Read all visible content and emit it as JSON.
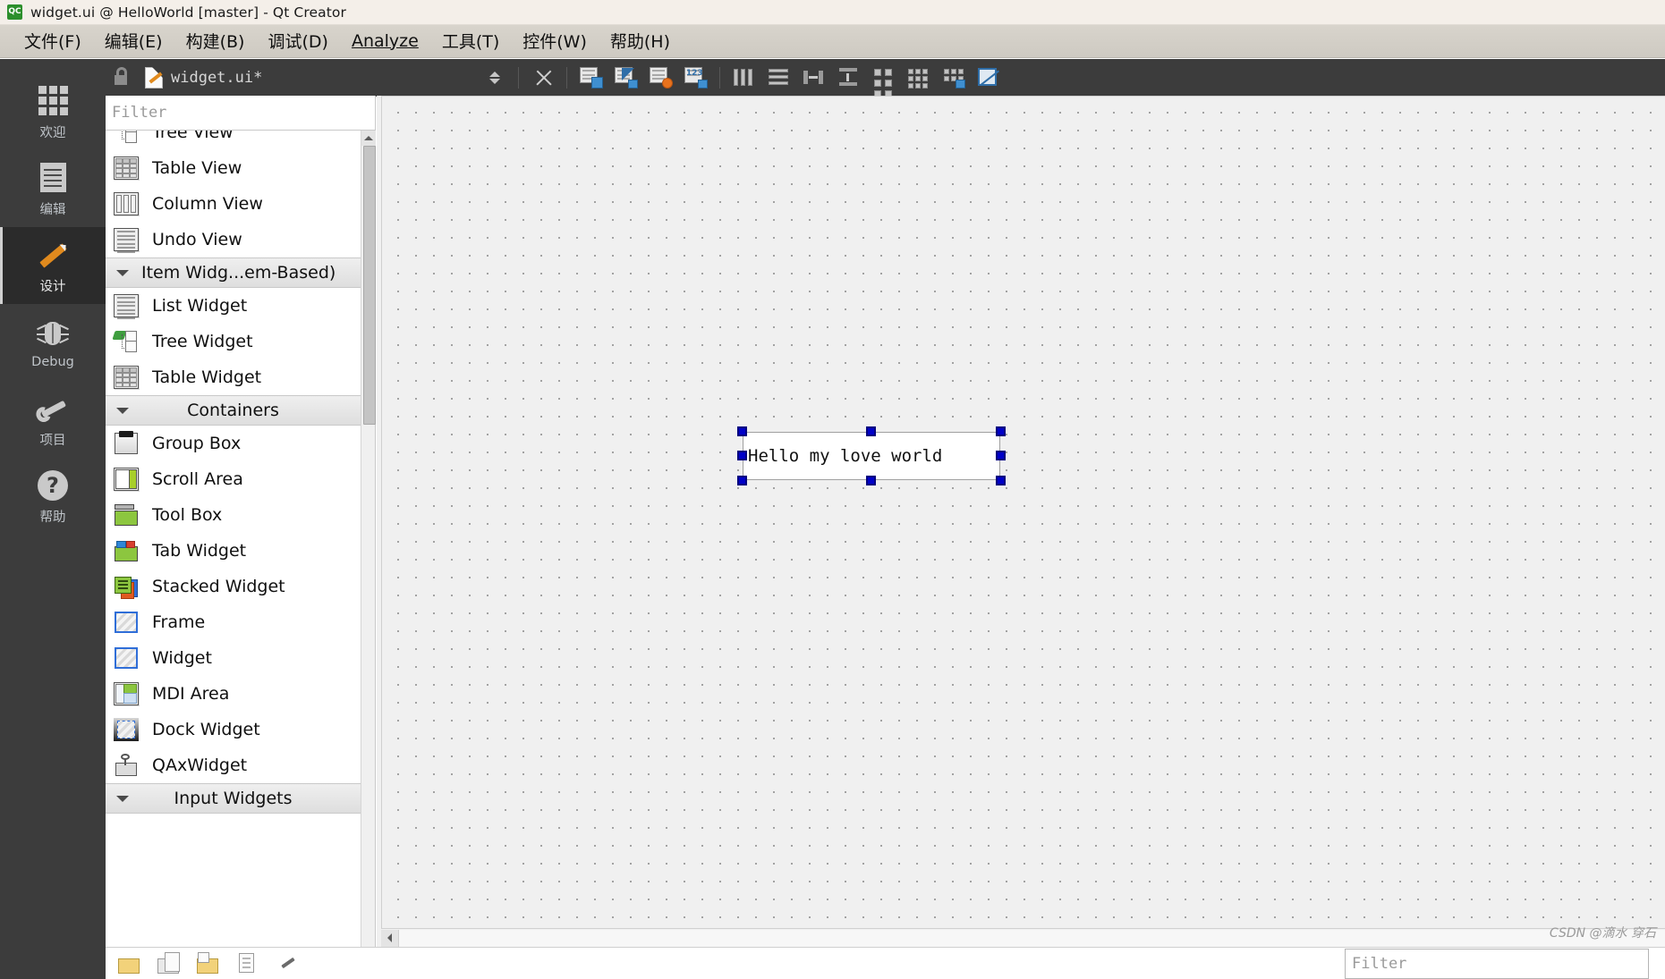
{
  "titlebar": {
    "logo_icon": "qt-creator-logo-icon",
    "title": "widget.ui @ HelloWorld [master] - Qt Creator"
  },
  "menubar": {
    "items": [
      {
        "label": "文件(F)",
        "mnemonic": "F"
      },
      {
        "label": "编辑(E)",
        "mnemonic": "E"
      },
      {
        "label": "构建(B)",
        "mnemonic": "B"
      },
      {
        "label": "调试(D)",
        "mnemonic": "D"
      },
      {
        "label": "Analyze",
        "mnemonic": "A"
      },
      {
        "label": "工具(T)",
        "mnemonic": "T"
      },
      {
        "label": "控件(W)",
        "mnemonic": "W"
      },
      {
        "label": "帮助(H)",
        "mnemonic": "H"
      }
    ]
  },
  "modebar": {
    "items": [
      {
        "label": "欢迎",
        "icon": "grid-icon",
        "active": false
      },
      {
        "label": "编辑",
        "icon": "document-icon",
        "active": false
      },
      {
        "label": "设计",
        "icon": "pencil-icon",
        "active": true
      },
      {
        "label": "Debug",
        "icon": "bug-icon",
        "active": false
      },
      {
        "label": "项目",
        "icon": "wrench-icon",
        "active": false
      },
      {
        "label": "帮助",
        "icon": "question-mark-icon",
        "active": false
      }
    ]
  },
  "editor_toolbar": {
    "lock_icon": "unlocked-padlock-icon",
    "file_icon": "file-edit-icon",
    "filename": "widget.ui*",
    "split_icon": "up-down-arrows-icon",
    "close_icon": "close-x-icon",
    "buttons": [
      {
        "name": "edit-widgets-icon",
        "tooltip": "Edit Widgets"
      },
      {
        "name": "edit-signals-slots-icon",
        "tooltip": "Edit Signals/Slots"
      },
      {
        "name": "edit-buddies-icon",
        "tooltip": "Edit Buddies"
      },
      {
        "name": "edit-tab-order-icon",
        "tooltip": "Edit Tab Order"
      },
      {
        "name": "layout-horizontally-icon",
        "tooltip": "Lay Out Horizontally"
      },
      {
        "name": "layout-vertically-icon",
        "tooltip": "Lay Out Vertically"
      },
      {
        "name": "layout-splitter-horizontal-icon",
        "tooltip": "Lay Out Horizontally in Splitter"
      },
      {
        "name": "layout-splitter-vertical-icon",
        "tooltip": "Lay Out Vertically in Splitter"
      },
      {
        "name": "layout-form-icon",
        "tooltip": "Lay Out in a Form Layout"
      },
      {
        "name": "layout-grid-icon",
        "tooltip": "Lay Out in a Grid"
      },
      {
        "name": "break-layout-icon",
        "tooltip": "Break Layout"
      },
      {
        "name": "adjust-size-icon",
        "tooltip": "Adjust Size"
      }
    ]
  },
  "widgetbox": {
    "filter_placeholder": "Filter",
    "filter_value": "",
    "rows": [
      {
        "type": "item",
        "label": "Tree View",
        "icon": "tree-view-icon"
      },
      {
        "type": "item",
        "label": "Table View",
        "icon": "table-view-icon"
      },
      {
        "type": "item",
        "label": "Column View",
        "icon": "column-view-icon"
      },
      {
        "type": "item",
        "label": "Undo View",
        "icon": "undo-view-icon"
      },
      {
        "type": "header",
        "label": "Item Widg...em-Based)",
        "align": "left",
        "expanded": true
      },
      {
        "type": "item",
        "label": "List Widget",
        "icon": "list-widget-icon"
      },
      {
        "type": "item",
        "label": "Tree Widget",
        "icon": "tree-widget-icon"
      },
      {
        "type": "item",
        "label": "Table Widget",
        "icon": "table-widget-icon"
      },
      {
        "type": "header",
        "label": "Containers",
        "align": "center",
        "expanded": true
      },
      {
        "type": "item",
        "label": "Group Box",
        "icon": "group-box-icon"
      },
      {
        "type": "item",
        "label": "Scroll Area",
        "icon": "scroll-area-icon"
      },
      {
        "type": "item",
        "label": "Tool Box",
        "icon": "tool-box-icon"
      },
      {
        "type": "item",
        "label": "Tab Widget",
        "icon": "tab-widget-icon"
      },
      {
        "type": "item",
        "label": "Stacked Widget",
        "icon": "stacked-widget-icon"
      },
      {
        "type": "item",
        "label": "Frame",
        "icon": "frame-icon"
      },
      {
        "type": "item",
        "label": "Widget",
        "icon": "widget-icon"
      },
      {
        "type": "item",
        "label": "MDI Area",
        "icon": "mdi-area-icon"
      },
      {
        "type": "item",
        "label": "Dock Widget",
        "icon": "dock-widget-icon"
      },
      {
        "type": "item",
        "label": "QAxWidget",
        "icon": "qax-widget-icon"
      },
      {
        "type": "header",
        "label": "Input Widgets",
        "align": "center",
        "expanded": true
      }
    ],
    "scrollbar": {
      "up_icon": "scroll-up-arrow-icon",
      "down_icon": "scroll-down-arrow-icon"
    }
  },
  "canvas": {
    "selected_widget": {
      "text": "Hello my love world",
      "handle_color": "#0000c8",
      "handles": [
        "nw",
        "n",
        "ne",
        "w",
        "e",
        "sw",
        "s",
        "se"
      ]
    },
    "hscroll": {
      "left_arrow_icon": "scroll-left-arrow-icon"
    }
  },
  "bottom_strip": {
    "icons": [
      {
        "name": "open-folder-icon"
      },
      {
        "name": "copy-files-icon"
      },
      {
        "name": "save-folder-icon"
      },
      {
        "name": "new-document-icon"
      },
      {
        "name": "wrench-tool-icon"
      }
    ],
    "filter_placeholder": "Filter"
  },
  "watermark": "CSDN @滴水 穿石"
}
